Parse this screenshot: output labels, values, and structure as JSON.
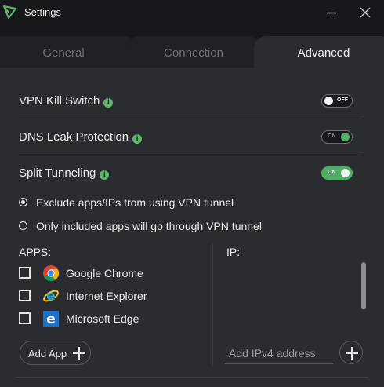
{
  "window": {
    "title": "Settings",
    "minimize_glyph": "—",
    "close_glyph": "✕"
  },
  "tabs": [
    {
      "label": "General",
      "active": false
    },
    {
      "label": "Connection",
      "active": false
    },
    {
      "label": "Advanced",
      "active": true
    }
  ],
  "settings": {
    "kill_switch": {
      "label": "VPN Kill Switch",
      "toggle_text": "OFF",
      "enabled": false
    },
    "dns_leak": {
      "label": "DNS Leak Protection",
      "toggle_text": "ON",
      "enabled": true
    },
    "split_tunneling": {
      "label": "Split Tunneling",
      "toggle_text": "ON",
      "enabled": true
    }
  },
  "info_glyph": "i",
  "split_options": [
    {
      "label": "Exclude apps/IPs from using VPN tunnel",
      "selected": true
    },
    {
      "label": "Only included apps will go through VPN tunnel",
      "selected": false
    }
  ],
  "apps_section": {
    "label": "APPS:",
    "items": [
      {
        "name": "Google Chrome",
        "icon": "chrome-icon",
        "checked": false
      },
      {
        "name": "Internet Explorer",
        "icon": "internet-explorer-icon",
        "checked": false
      },
      {
        "name": "Microsoft Edge",
        "icon": "edge-icon",
        "checked": false
      }
    ],
    "add_button": "Add App"
  },
  "ip_section": {
    "label": "IP:",
    "input_placeholder": "Add IPv4 address",
    "input_value": ""
  },
  "colors": {
    "accent_green": "#4fae63",
    "background": "#2a2c30",
    "titlebar": "#17181b"
  }
}
